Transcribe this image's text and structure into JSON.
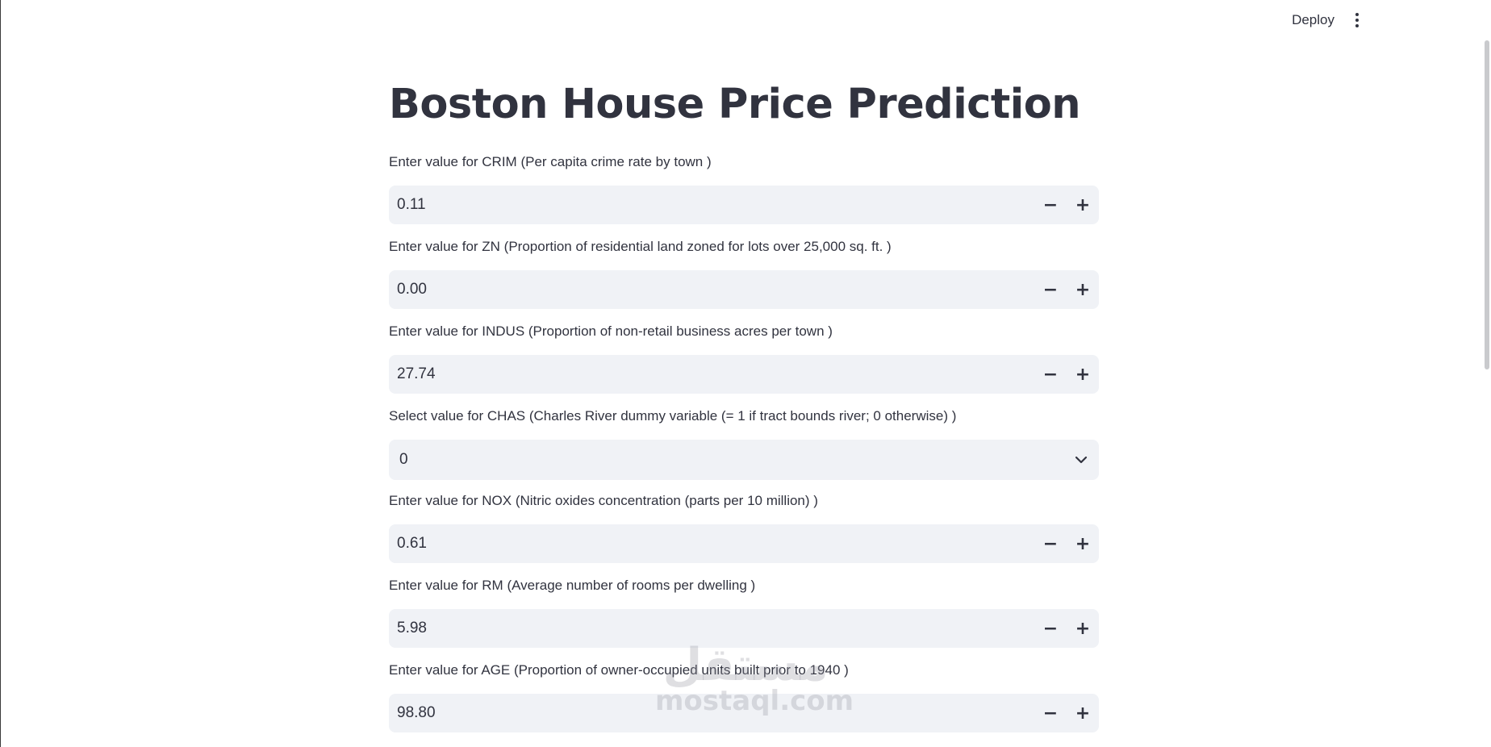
{
  "header": {
    "deploy_label": "Deploy",
    "menu_icon": "kebab-vertical-icon"
  },
  "page": {
    "title": "Boston House Price Prediction"
  },
  "fields": [
    {
      "label": "Enter value for CRIM (Per capita crime rate by town )",
      "value": "0.11",
      "type": "number"
    },
    {
      "label": "Enter value for ZN (Proportion of residential land zoned for lots over 25,000 sq. ft. )",
      "value": "0.00",
      "type": "number"
    },
    {
      "label": "Enter value for INDUS (Proportion of non-retail business acres per town )",
      "value": "27.74",
      "type": "number"
    },
    {
      "label": "Select value for CHAS (Charles River dummy variable (= 1 if tract bounds river; 0 otherwise) )",
      "value": "0",
      "type": "select"
    },
    {
      "label": "Enter value for NOX (Nitric oxides concentration (parts per 10 million) )",
      "value": "0.61",
      "type": "number"
    },
    {
      "label": "Enter value for RM (Average number of rooms per dwelling )",
      "value": "5.98",
      "type": "number"
    },
    {
      "label": "Enter value for AGE (Proportion of owner-occupied units built prior to 1940 )",
      "value": "98.80",
      "type": "number"
    }
  ],
  "stepper": {
    "minus": "−",
    "plus": "+"
  },
  "watermark": {
    "arabic": "مستقل",
    "latin": "mostaql.com"
  },
  "colors": {
    "text": "#31333f",
    "input_bg": "#f0f2f6",
    "background": "#ffffff"
  }
}
